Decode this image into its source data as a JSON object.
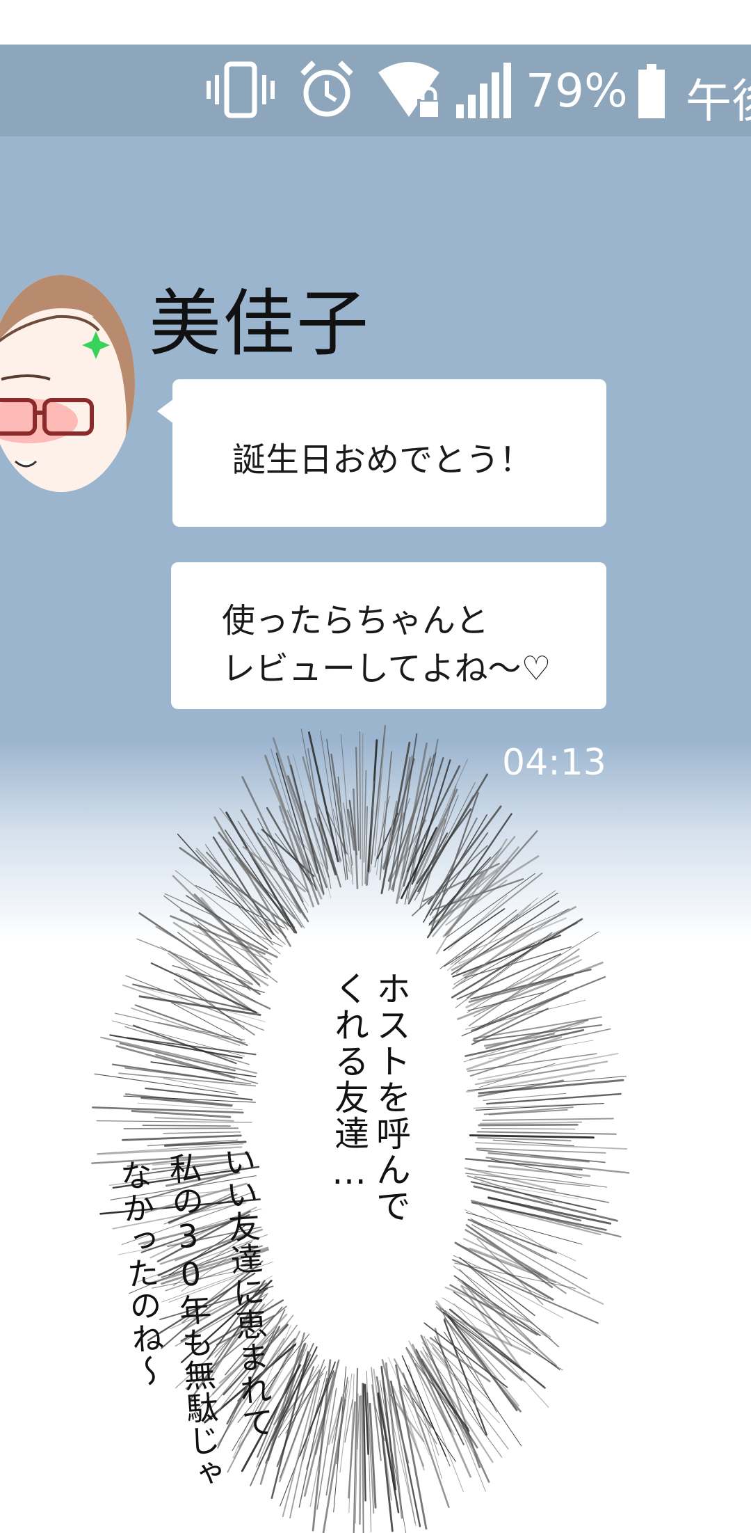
{
  "status_bar": {
    "battery_percent": "79%",
    "time_partial": "午後",
    "icons": [
      "vibrate-icon",
      "alarm-clock-icon",
      "wifi-locked-icon",
      "signal-bars-icon",
      "battery-icon"
    ]
  },
  "chat": {
    "sender_name": "美佳子",
    "messages": [
      {
        "lines": [
          "誕生日おめでとう！"
        ]
      },
      {
        "lines": [
          "使ったらちゃんと",
          "レビューしてよね～♡"
        ]
      }
    ],
    "timestamp": "04:13"
  },
  "narration": {
    "center_lines": [
      "ホストを呼んで",
      "くれる友達…"
    ],
    "aside_lines": [
      "いい友達に恵まれて",
      "私の30年も無駄じゃ",
      "なかったのね～"
    ]
  },
  "colors": {
    "chat_background": "#9cb5cf",
    "status_bar": "#8ea6bc",
    "bubble": "#ffffff",
    "timestamp": "#ffffff"
  }
}
